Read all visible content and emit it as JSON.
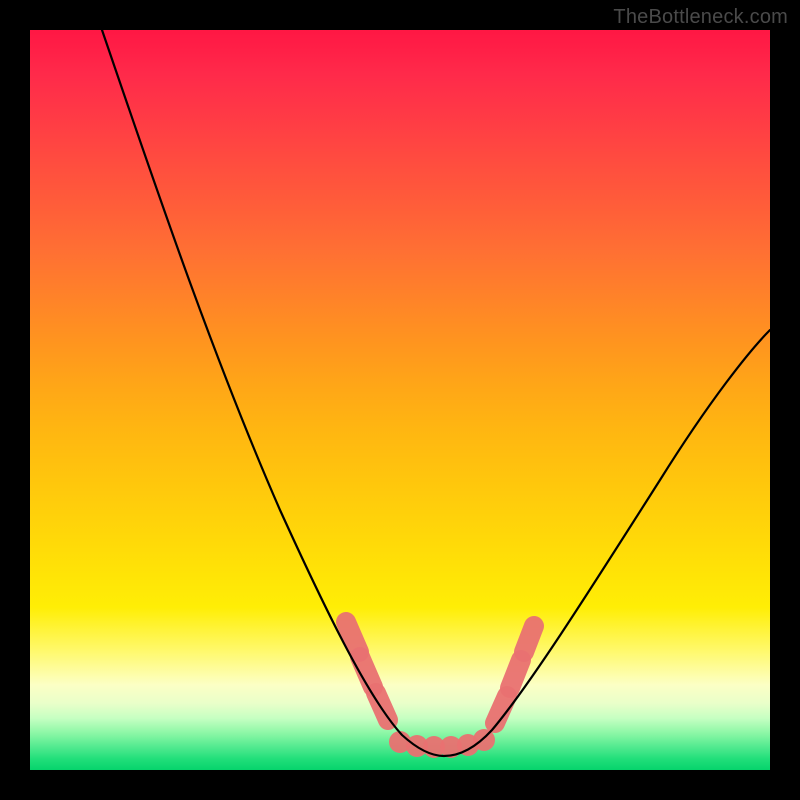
{
  "watermark": "TheBottleneck.com",
  "colors": {
    "frame": "#000000",
    "gradient_top": "#ff1744",
    "gradient_mid": "#ffd20a",
    "gradient_bottom": "#06d46c",
    "curve": "#000000",
    "marker": "#e97171"
  },
  "chart_data": {
    "type": "line",
    "title": "",
    "xlabel": "",
    "ylabel": "",
    "xlim": [
      0,
      100
    ],
    "ylim": [
      0,
      100
    ],
    "grid": false,
    "legend": false,
    "x": [
      10,
      15,
      20,
      25,
      30,
      35,
      40,
      44,
      46,
      48,
      50,
      52,
      54,
      56,
      58,
      60,
      65,
      70,
      75,
      80,
      85,
      90,
      95,
      100
    ],
    "values": [
      100,
      87,
      75,
      63,
      51,
      40,
      29,
      20,
      16,
      12,
      9,
      6,
      4,
      3,
      2,
      3,
      7,
      13,
      20,
      28,
      36,
      44,
      51,
      58
    ],
    "annotations": [
      {
        "type": "marker",
        "shape": "capsule",
        "x": 44.5,
        "y": 17
      },
      {
        "type": "marker",
        "shape": "capsule",
        "x": 46.5,
        "y": 12
      },
      {
        "type": "marker",
        "shape": "capsule",
        "x": 48.5,
        "y": 8
      },
      {
        "type": "marker",
        "shape": "dot",
        "x": 50.0,
        "y": 3
      },
      {
        "type": "marker",
        "shape": "dot",
        "x": 52.0,
        "y": 3
      },
      {
        "type": "marker",
        "shape": "dot",
        "x": 54.0,
        "y": 3
      },
      {
        "type": "marker",
        "shape": "dot",
        "x": 56.0,
        "y": 3
      },
      {
        "type": "marker",
        "shape": "dot",
        "x": 58.0,
        "y": 3
      },
      {
        "type": "marker",
        "shape": "dot",
        "x": 60.0,
        "y": 3
      },
      {
        "type": "marker",
        "shape": "capsule",
        "x": 62.5,
        "y": 8
      },
      {
        "type": "marker",
        "shape": "capsule",
        "x": 64.0,
        "y": 12
      },
      {
        "type": "marker",
        "shape": "capsule",
        "x": 66.0,
        "y": 17
      }
    ],
    "notes": "V-shaped bottleneck curve over rainbow heat gradient; minimum near x≈55, y≈2%."
  }
}
